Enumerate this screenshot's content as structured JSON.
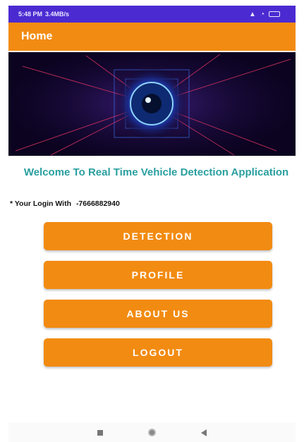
{
  "status_bar": {
    "time": "5:48 PM",
    "speed": "3.4MB/s",
    "signal": "4G",
    "wifi": "Wi-Fi"
  },
  "app_bar": {
    "title": "Home"
  },
  "banner": {
    "image_icon": "eye-lens-icon"
  },
  "welcome_text": "Welcome To Real Time Vehicle Detection Application",
  "login": {
    "prefix": "* Your Login With",
    "number": "-7666882940"
  },
  "buttons": {
    "detection": "DETECTION",
    "profile": "PROFILE",
    "about_us": "ABOUT US",
    "logout": "LOGOUT"
  },
  "nav": {
    "recent_icon": "square-icon",
    "home_icon": "circle-icon",
    "back_icon": "back-triangle-icon"
  },
  "colors": {
    "accent": "#f28b12",
    "status_bar": "#4b2bd1",
    "welcome_text": "#2a9fa0"
  }
}
